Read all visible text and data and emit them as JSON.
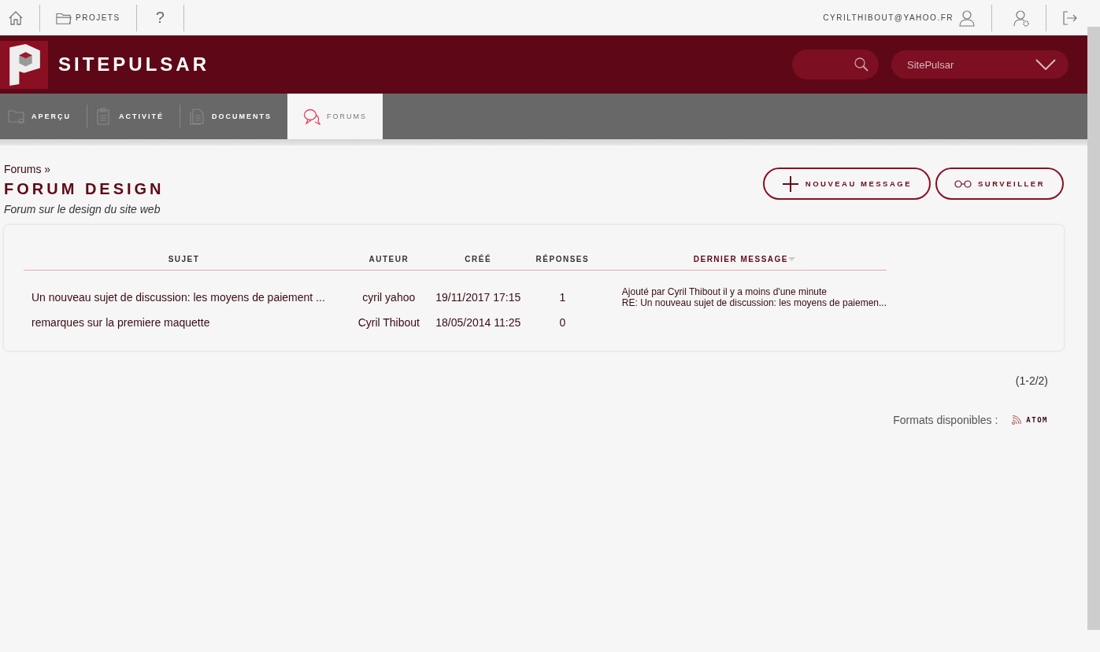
{
  "top_bar": {
    "projects_label": "PROJETS",
    "help_label": "?",
    "user_email": "CYRILTHIBOUT@YAHOO.FR"
  },
  "header": {
    "site_name": "SITEPULSAR",
    "project_select": "SitePulsar"
  },
  "tabs": [
    {
      "label": "APERÇU",
      "selected": false
    },
    {
      "label": "ACTIVITÉ",
      "selected": false
    },
    {
      "label": "DOCUMENTS",
      "selected": false
    },
    {
      "label": "FORUMS",
      "selected": true
    }
  ],
  "breadcrumb": "Forums »",
  "title": "FORUM DESIGN",
  "subtitle": "Forum sur le design du site web",
  "buttons": [
    "NOUVEAU MESSAGE",
    "SURVEILLER"
  ],
  "table": {
    "columns": [
      {
        "label": "SUJET",
        "sorted": false
      },
      {
        "label": "AUTEUR",
        "sorted": false
      },
      {
        "label": "CRÉÉ",
        "sorted": false
      },
      {
        "label": "RÉPONSES",
        "sorted": false
      },
      {
        "label": "DERNIER MESSAGE",
        "sorted": true
      }
    ],
    "rows": [
      {
        "subject": "Un nouveau sujet de discussion: les moyens de paiement ...",
        "author": "cyril yahoo",
        "created": "19/11/2017 17:15",
        "replies": "1",
        "last_message": [
          "Ajouté par Cyril Thibout il y a moins d'une minute",
          "RE: Un nouveau sujet de discussion: les moyens de paiemen..."
        ]
      },
      {
        "subject": "remarques sur la premiere maquette",
        "author": "Cyril Thibout",
        "created": "18/05/2014 11:25",
        "replies": "0",
        "last_message": []
      }
    ]
  },
  "pagination": "(1-2/2)",
  "formats": {
    "label": "Formats disponibles :",
    "links": [
      "ATOM"
    ]
  }
}
